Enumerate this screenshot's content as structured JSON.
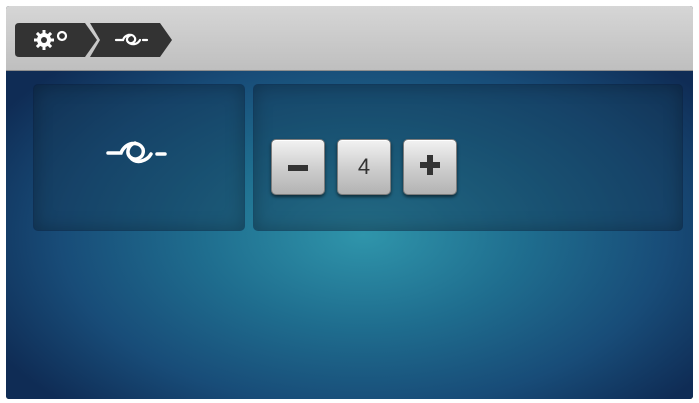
{
  "breadcrumb": {
    "items": [
      {
        "icon": "settings-icon"
      },
      {
        "icon": "knot-tie-off-icon"
      }
    ]
  },
  "panel": {
    "icon": "knot-tie-off-icon"
  },
  "stepper": {
    "minus_icon": "minus-icon",
    "value": "4",
    "plus_icon": "plus-icon"
  }
}
